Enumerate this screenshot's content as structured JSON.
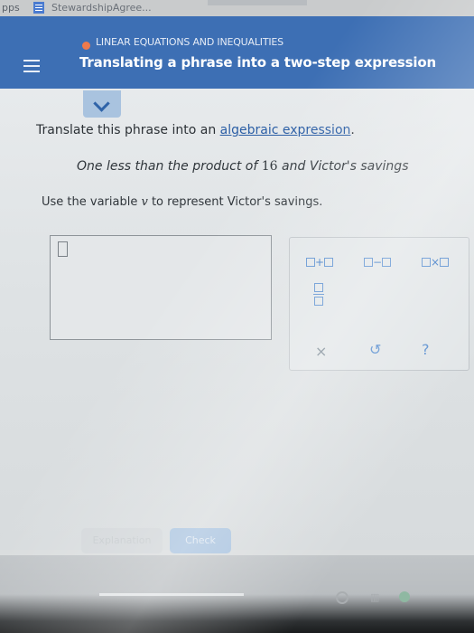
{
  "bookmarks": {
    "apps": "pps",
    "steward": "StewardshipAgree..."
  },
  "header": {
    "topic": "LINEAR EQUATIONS AND INEQUALITIES",
    "title": "Translating a phrase into a two-step expression"
  },
  "question": {
    "prompt_before": "Translate this phrase into an ",
    "prompt_link": "algebraic expression",
    "prompt_after": ".",
    "phrase_a": "One less than the product of ",
    "phrase_num": "16",
    "phrase_b": " and Victor's savings",
    "use_before": "Use the variable ",
    "use_var": "v",
    "use_after": " to represent Victor's savings."
  },
  "keypad": {
    "plus": "+",
    "minus": "−",
    "times": "×",
    "clear": "×",
    "undo": "↺",
    "help": "?"
  },
  "buttons": {
    "explanation": "Explanation",
    "check": "Check"
  },
  "colors": {
    "header_bg": "#3d6fb4",
    "accent": "#2b5ea5",
    "topic_dot": "#ee7a4c"
  }
}
